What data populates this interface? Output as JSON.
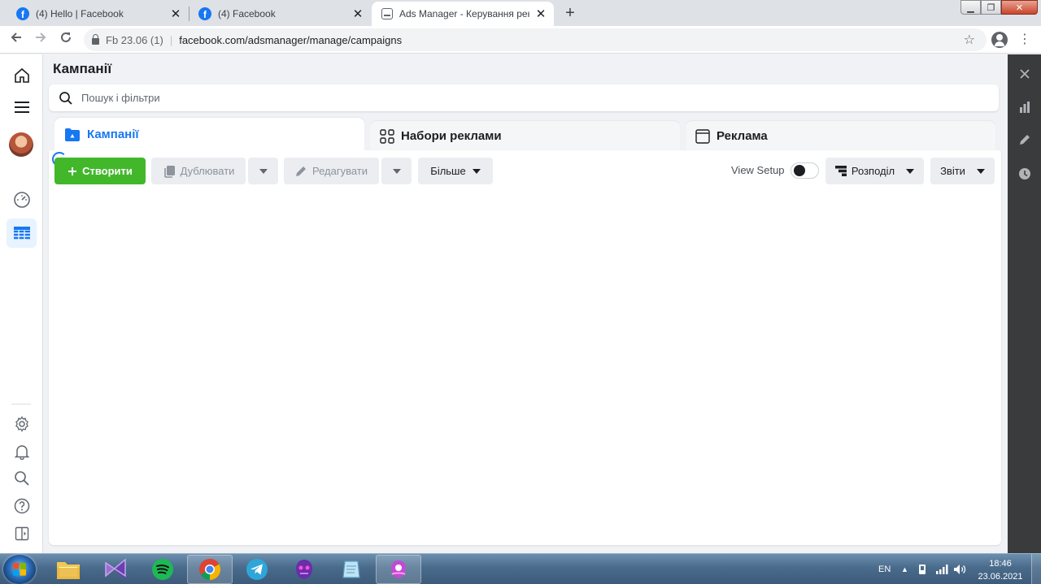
{
  "browser": {
    "tabs": [
      {
        "title": "(4) Hello | Facebook",
        "favicon": "facebook-icon",
        "active": false
      },
      {
        "title": "(4) Facebook",
        "favicon": "facebook-icon",
        "active": false
      },
      {
        "title": "Ads Manager - Керування рекла",
        "favicon": "ads-manager-icon",
        "active": true
      }
    ],
    "site_label": "Fb 23.06 (1)",
    "url": "facebook.com/adsmanager/manage/campaigns"
  },
  "page": {
    "title": "Кампанії",
    "search_placeholder": "Пошук і фільтри"
  },
  "level_tabs": [
    {
      "label": "Кампанії",
      "icon": "campaign-folder-icon",
      "active": true
    },
    {
      "label": "Набори реклами",
      "icon": "ad-sets-grid-icon",
      "active": false
    },
    {
      "label": "Реклама",
      "icon": "ad-window-icon",
      "active": false
    }
  ],
  "toolbar": {
    "create_label": "Створити",
    "duplicate_label": "Дублювати",
    "edit_label": "Редагувати",
    "more_label": "Більше",
    "view_setup_label": "View Setup",
    "view_setup_on": false,
    "breakdown_label": "Розподіл",
    "reports_label": "Звіти"
  },
  "taskbar": {
    "language": "EN",
    "time": "18:46",
    "date": "23.06.2021",
    "apps": [
      "file-explorer-icon",
      "visual-studio-icon",
      "spotify-icon",
      "chrome-icon",
      "telegram-icon",
      "game-app-icon",
      "notes-app-icon",
      "purple-app-icon"
    ]
  },
  "colors": {
    "facebook_blue": "#1877f2",
    "create_green": "#42b72a",
    "right_rail": "#3a3b3c"
  }
}
